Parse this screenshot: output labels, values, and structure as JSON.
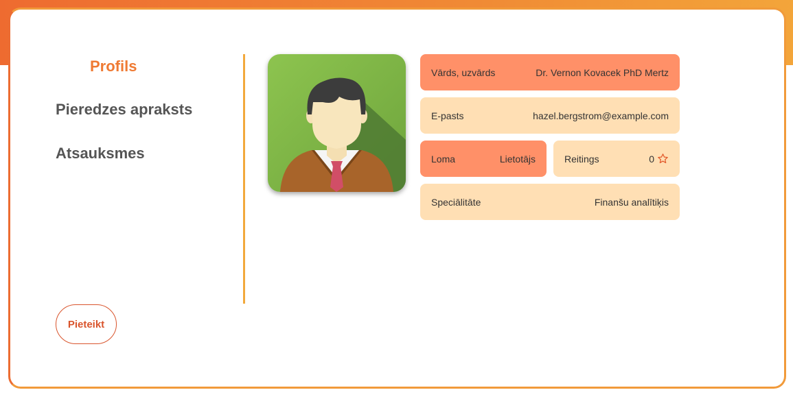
{
  "nav": {
    "items": [
      {
        "label": "Profils",
        "active": true
      },
      {
        "label": "Pieredzes apraksts",
        "active": false
      },
      {
        "label": "Atsauksmes",
        "active": false
      }
    ]
  },
  "actions": {
    "report_label": "Pieteikt"
  },
  "profile": {
    "avatar_icon": "male-user-avatar-icon",
    "name": {
      "label": "Vārds, uzvārds",
      "value": "Dr. Vernon Kovacek PhD Mertz"
    },
    "email": {
      "label": "E-pasts",
      "value": "hazel.bergstrom@example.com"
    },
    "role": {
      "label": "Loma",
      "value": "Lietotājs"
    },
    "rating": {
      "label": "Reitings",
      "value": "0",
      "icon": "star-outline-icon"
    },
    "specialty": {
      "label": "Speciālitāte",
      "value": "Finanšu analītiķis"
    }
  },
  "colors": {
    "accent": "#ef7a33",
    "field_strong": "#ff9068",
    "field_soft": "#ffdfb4",
    "divider": "#f2a93c",
    "report_button": "#d9542c"
  }
}
